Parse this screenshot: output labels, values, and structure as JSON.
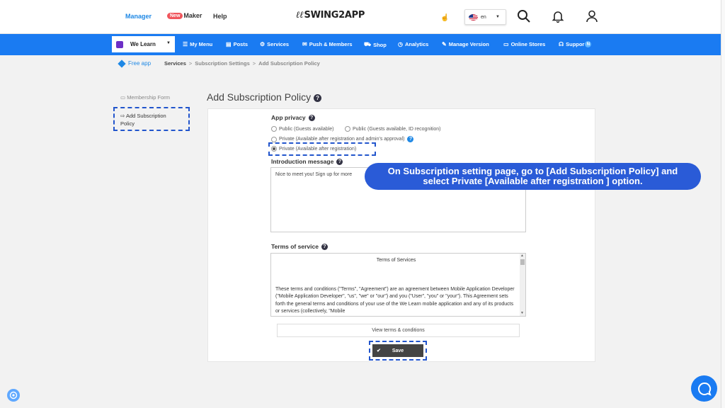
{
  "header": {
    "nav": {
      "manager": "Manager",
      "new_badge": "New",
      "maker": "Maker",
      "help": "Help"
    },
    "logo": "SWING2APP",
    "language": "en"
  },
  "navbar": {
    "app_name": "We Learn",
    "items": {
      "my_menu": "My Menu",
      "posts": "Posts",
      "services": "Services",
      "push_members": "Push & Members",
      "shop": "Shop",
      "analytics": "Analytics",
      "manage_version": "Manage Version",
      "online_stores": "Online Stores",
      "support": "Suppor",
      "support_badge": "N"
    }
  },
  "breadcrumb": {
    "free_app": "Free app",
    "items": [
      "Services",
      "Subscription Settings",
      "Add Subscription Policy"
    ]
  },
  "sidebar": {
    "membership_form": "Membership Form",
    "add_policy_line1": "Add Subscription",
    "add_policy_line2": "Policy"
  },
  "page": {
    "title": "Add Subscription Policy",
    "app_privacy_label": "App privacy",
    "privacy_options": {
      "public": "Public (Guests available)",
      "public_id": "Public (Guests available, ID recognition)",
      "private_approval": "Private (Available after registration and admin's approval)",
      "private_reg": "Private (Available after registration)"
    },
    "intro_label": "Introduction message",
    "intro_value": "Nice to meet you! Sign up for more",
    "terms_label": "Terms of service",
    "terms_title": "Terms of Services",
    "terms_body": "These terms and conditions (\"Terms\", \"Agreement\") are an agreement between Mobile Application Developer (\"Mobile Application Developer\", \"us\", \"we\" or \"our\") and you (\"User\", \"you\" or \"your\"). This Agreement sets forth the general terms and conditions of your use of the We Learn mobile application and any of its products or services (collectively, \"Mobile",
    "view_terms": "View terms & conditions",
    "save": "Save"
  },
  "tooltip": {
    "line1": "On Subscription setting page, go to [Add Subscription  Policy] and",
    "line2": "select Private [Available after registration ] option."
  }
}
